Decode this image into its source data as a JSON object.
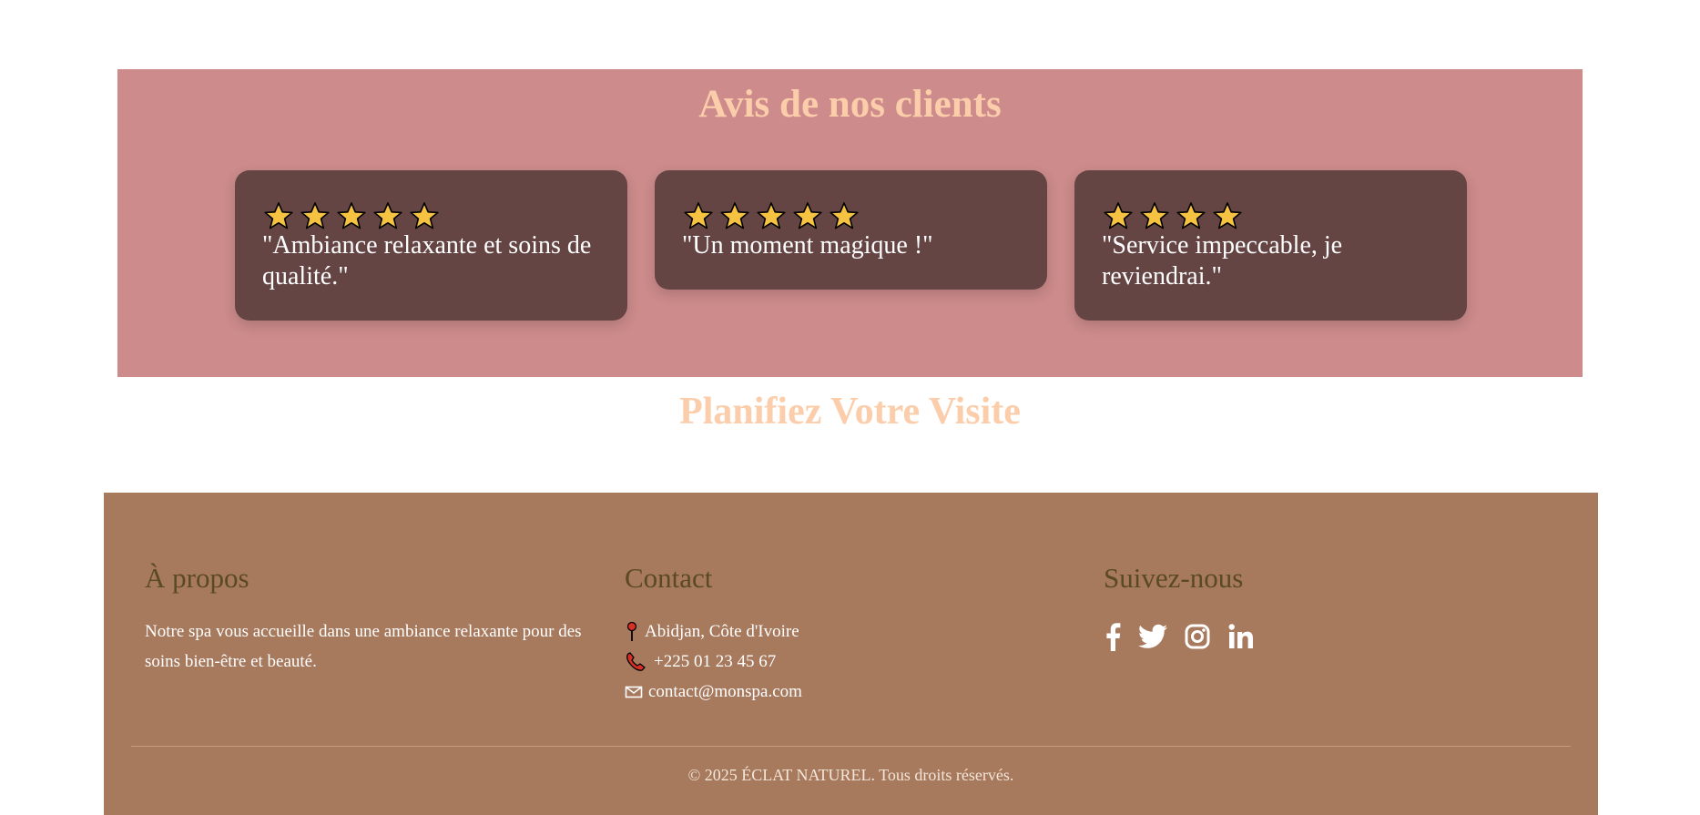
{
  "reviews": {
    "title": "Avis de nos clients",
    "items": [
      {
        "rating": 5,
        "quote": "\"Ambiance relaxante et soins de qualité.\""
      },
      {
        "rating": 5,
        "quote": "\"Un moment magique !\""
      },
      {
        "rating": 4,
        "quote": "\"Service impeccable, je reviendrai.\""
      }
    ],
    "colors": {
      "background": "#cd8b8b",
      "card": "#654444",
      "title": "#fbcdaa",
      "star": "#f5c242"
    }
  },
  "visit": {
    "title": "Planifiez Votre Visite"
  },
  "footer": {
    "about": {
      "heading": "À propos",
      "text": "Notre spa vous accueille dans une ambiance relaxante pour des soins bien-être et beauté."
    },
    "contact": {
      "heading": "Contact",
      "address": "Abidjan, Côte d'Ivoire",
      "phone": "+225 01 23 45 67",
      "email": "contact@monspa.com",
      "icons": [
        "pushpin-icon",
        "phone-icon",
        "envelope-icon"
      ]
    },
    "social": {
      "heading": "Suivez-nous",
      "icons": [
        "facebook-icon",
        "twitter-icon",
        "instagram-icon",
        "linkedin-icon"
      ]
    },
    "copyright": "© 2025 ÉCLAT NATUREL. Tous droits réservés.",
    "colors": {
      "background": "#a7795d",
      "heading": "#5a4a22"
    }
  }
}
